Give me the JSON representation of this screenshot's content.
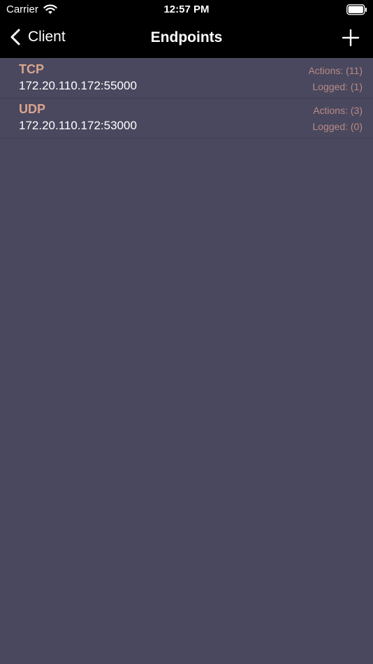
{
  "status_bar": {
    "carrier": "Carrier",
    "time": "12:57 PM"
  },
  "nav": {
    "back_label": "Client",
    "title": "Endpoints"
  },
  "endpoints": [
    {
      "protocol": "TCP",
      "address": "172.20.110.172:55000",
      "actions": "Actions: (11)",
      "logged": "Logged: (1)"
    },
    {
      "protocol": "UDP",
      "address": "172.20.110.172:53000",
      "actions": "Actions: (3)",
      "logged": "Logged: (0)"
    }
  ],
  "icons": {
    "wifi": "wifi-icon",
    "battery": "battery-icon",
    "back": "chevron-left-icon",
    "add": "plus-icon"
  },
  "colors": {
    "background": "#4a485e",
    "bar": "#000000",
    "protocol": "#d9a48e",
    "meta": "#b88a86",
    "separator": "#3e3c51"
  }
}
